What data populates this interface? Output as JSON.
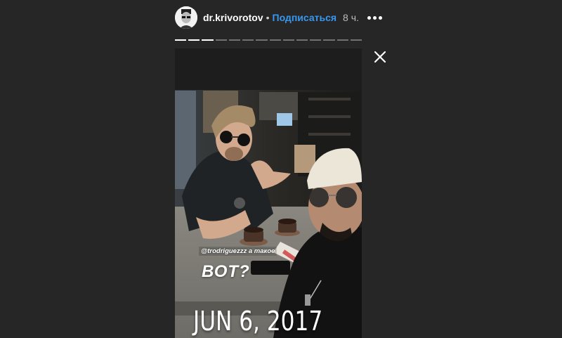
{
  "header": {
    "username": "dr.krivorotov",
    "separator": "•",
    "follow_label": "Подписаться",
    "time": "8 ч."
  },
  "progress": {
    "total_segments": 14,
    "completed_segments": 3
  },
  "story": {
    "mention_text": "@trodriguezzz а такое",
    "sticker_text": "ВОТ?",
    "date_stamp": "JUN 6, 2017"
  },
  "icons": {
    "more": "more-dots-icon",
    "close": "close-icon"
  },
  "colors": {
    "background": "#262626",
    "link": "#3897f0"
  }
}
